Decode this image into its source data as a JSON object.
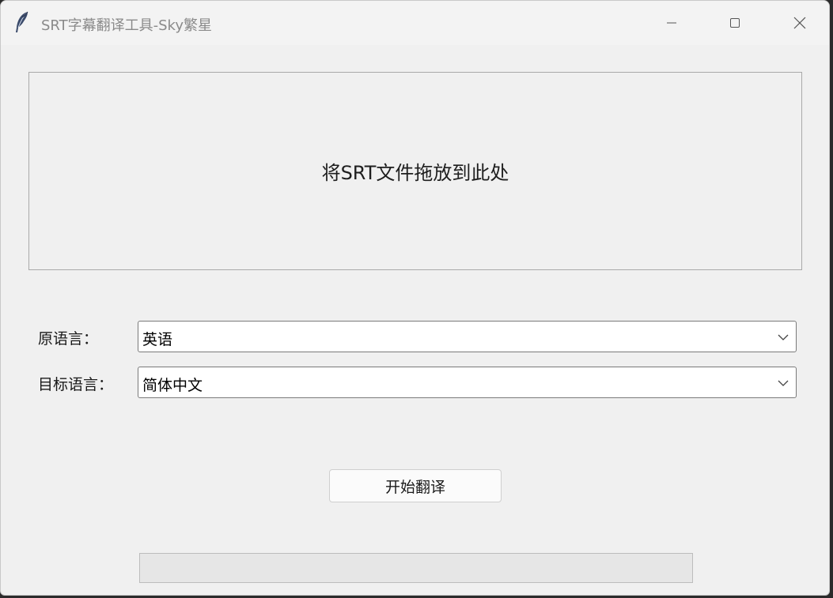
{
  "window": {
    "title": "SRT字幕翻译工具-Sky繁星",
    "icon": "feather-icon",
    "controls": [
      "minimize-icon",
      "maximize-icon",
      "close-icon"
    ]
  },
  "drop_zone": {
    "text": "将SRT文件拖放到此处"
  },
  "source_language": {
    "label": "原语言：",
    "value": "英语"
  },
  "target_language": {
    "label": "目标语言：",
    "value": "简体中文"
  },
  "start_button": {
    "label": "开始翻译"
  },
  "progress": {
    "value": 0
  }
}
